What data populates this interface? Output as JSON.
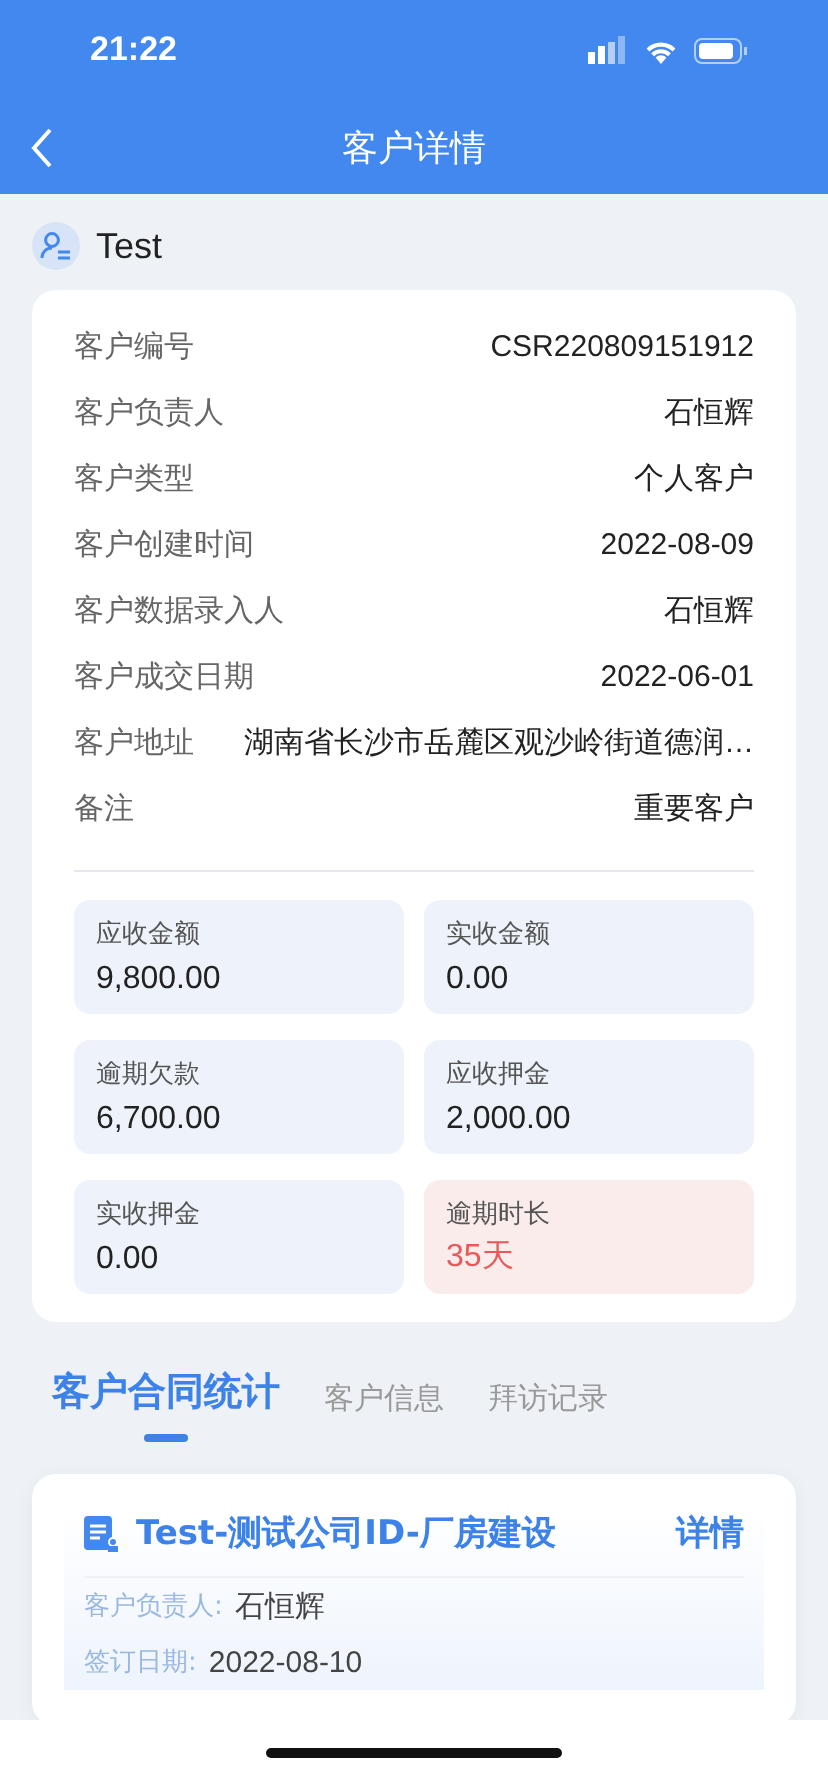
{
  "status_bar": {
    "time": "21:22"
  },
  "nav": {
    "title": "客户详情"
  },
  "customer": {
    "name": "Test"
  },
  "details": [
    {
      "label": "客户编号",
      "value": "CSR220809151912"
    },
    {
      "label": "客户负责人",
      "value": "石恒辉"
    },
    {
      "label": "客户类型",
      "value": "个人客户"
    },
    {
      "label": "客户创建时间",
      "value": "2022-08-09"
    },
    {
      "label": "客户数据录入人",
      "value": "石恒辉"
    },
    {
      "label": "客户成交日期",
      "value": "2022-06-01"
    },
    {
      "label": "客户地址",
      "value": "湖南省长沙市岳麓区观沙岭街道德润…"
    },
    {
      "label": "备注",
      "value": "重要客户"
    }
  ],
  "stats": [
    {
      "label": "应收金额",
      "value": "9,800.00",
      "kind": "normal"
    },
    {
      "label": "实收金额",
      "value": "0.00",
      "kind": "normal"
    },
    {
      "label": "逾期欠款",
      "value": "6,700.00",
      "kind": "normal"
    },
    {
      "label": "应收押金",
      "value": "2,000.00",
      "kind": "normal"
    },
    {
      "label": "实收押金",
      "value": "0.00",
      "kind": "normal"
    },
    {
      "label": "逾期时长",
      "value": "35天",
      "kind": "alert"
    }
  ],
  "tabs": [
    {
      "label": "客户合同统计",
      "selected": true
    },
    {
      "label": "客户信息",
      "selected": false
    },
    {
      "label": "拜访记录",
      "selected": false
    }
  ],
  "contract": {
    "title": "Test-测试公司ID-厂房建设",
    "link": "详情",
    "fields": [
      {
        "label": "客户负责人:",
        "value": "石恒辉"
      },
      {
        "label": "签订日期:",
        "value": "2022-08-10"
      }
    ]
  }
}
